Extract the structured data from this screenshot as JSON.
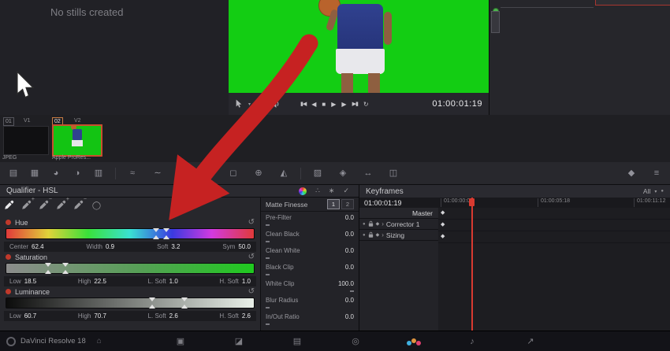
{
  "colors": {
    "annotation_arrow": "#c62222",
    "green_screen": "#13cd13",
    "playhead": "#d83a30",
    "clip_selection": "#c8502e"
  },
  "glyphs": {
    "caret_down": "▾",
    "reset": "↺",
    "keyframe_diamond": "◆",
    "enable_dot": "●",
    "expand_chevron": "›",
    "circle_tool": "◯",
    "nodes_icon": "∴",
    "snowflake_icon": "∗",
    "check_icon": "✓",
    "home": "⌂"
  },
  "gallery": {
    "empty_text": "No stills created"
  },
  "viewer": {
    "timecode": "01:00:01:19",
    "tool_icons": [
      "pointer-mode",
      "unmix-stack",
      "speaker"
    ],
    "transport": [
      {
        "name": "jump-start",
        "glyph": "▮◀"
      },
      {
        "name": "step-back",
        "glyph": "◀"
      },
      {
        "name": "stop",
        "glyph": "■"
      },
      {
        "name": "play",
        "glyph": "▶"
      },
      {
        "name": "step-forward",
        "glyph": "▶"
      },
      {
        "name": "jump-end",
        "glyph": "▶▮"
      },
      {
        "name": "loop",
        "glyph": "↻"
      }
    ]
  },
  "clipstrip": {
    "clips": [
      {
        "number": "01",
        "track": "V1",
        "codec": "JPEG",
        "selected": false
      },
      {
        "number": "02",
        "track": "V2",
        "codec": "Apple ProRes...",
        "selected": true
      }
    ]
  },
  "palette_toolbar": {
    "items": [
      {
        "name": "camera-raw",
        "glyph": "▤"
      },
      {
        "name": "color-match",
        "glyph": "▦"
      },
      {
        "name": "color-wheels",
        "glyph": "◕"
      },
      {
        "name": "hdr",
        "glyph": "◑"
      },
      {
        "name": "rgb-mixer",
        "glyph": "▥"
      },
      {
        "name": "motion-effects",
        "glyph": "≈"
      },
      {
        "name": "curves",
        "glyph": "∼"
      },
      {
        "name": "color-warper",
        "glyph": "◇"
      },
      {
        "name": "qualifier",
        "active": true
      },
      {
        "name": "window",
        "glyph": "◻"
      },
      {
        "name": "tracker",
        "glyph": "⊕"
      },
      {
        "name": "magic-mask",
        "glyph": "◭"
      },
      {
        "name": "blur",
        "glyph": "▨"
      },
      {
        "name": "key",
        "glyph": "◈"
      },
      {
        "name": "sizing",
        "glyph": "↔"
      },
      {
        "name": "stereo-3d",
        "glyph": "◫"
      }
    ],
    "right_items": [
      {
        "name": "keyframes-toggle",
        "glyph": "◆"
      },
      {
        "name": "panel-menu",
        "glyph": "≡"
      }
    ]
  },
  "qualifier": {
    "title": "Qualifier - HSL",
    "header_icons": [
      "color-wheel",
      "nodes",
      "snowflake",
      "matte-check"
    ],
    "picker_tools": [
      {
        "name": "eyedropper",
        "mod": ""
      },
      {
        "name": "eyedropper-add",
        "mod": "+"
      },
      {
        "name": "eyedropper-subtract",
        "mod": "−"
      },
      {
        "name": "softness-add",
        "mod": "+"
      },
      {
        "name": "softness-subtract",
        "mod": "−"
      },
      {
        "name": "mask-invert",
        "mod": ""
      }
    ],
    "sections": [
      {
        "name": "Hue",
        "params": [
          {
            "label": "Center",
            "value": "62.4"
          },
          {
            "label": "Width",
            "value": "0.9"
          },
          {
            "label": "Soft",
            "value": "3.2"
          },
          {
            "label": "Sym",
            "value": "50.0"
          }
        ]
      },
      {
        "name": "Saturation",
        "params": [
          {
            "label": "Low",
            "value": "18.5"
          },
          {
            "label": "High",
            "value": "22.5"
          },
          {
            "label": "L. Soft",
            "value": "1.0"
          },
          {
            "label": "H. Soft",
            "value": "1.0"
          }
        ]
      },
      {
        "name": "Luminance",
        "params": [
          {
            "label": "Low",
            "value": "60.7"
          },
          {
            "label": "High",
            "value": "70.7"
          },
          {
            "label": "L. Soft",
            "value": "2.6"
          },
          {
            "label": "H. Soft",
            "value": "2.6"
          }
        ]
      }
    ]
  },
  "matte_finesse": {
    "title": "Matte Finesse",
    "pages": [
      {
        "label": "1",
        "active": true
      },
      {
        "label": "2",
        "active": false
      }
    ],
    "params": [
      {
        "label": "Pre-Filter",
        "value": "0.0"
      },
      {
        "label": "Clean Black",
        "value": "0.0"
      },
      {
        "label": "Clean White",
        "value": "0.0"
      },
      {
        "label": "Black Clip",
        "value": "0.0"
      },
      {
        "label": "White Clip",
        "value": "100.0"
      },
      {
        "label": "Blur Radius",
        "value": "0.0"
      },
      {
        "label": "In/Out Ratio",
        "value": "0.0"
      }
    ]
  },
  "keyframes": {
    "title": "Keyframes",
    "filter": "All",
    "current_timecode": "01:00:01:19",
    "ruler_labels": [
      "01:00:00:00",
      "01:00:05:18",
      "01:00:11:12"
    ],
    "tracks": [
      {
        "label": "Master",
        "keyframe": true
      },
      {
        "label": "Corrector 1",
        "keyframe": true
      },
      {
        "label": "Sizing",
        "keyframe": true
      }
    ]
  },
  "statusbar": {
    "app_label": "DaVinci Resolve 18",
    "pages": [
      {
        "name": "media",
        "glyph": "▣",
        "active": false
      },
      {
        "name": "cut",
        "glyph": "◪",
        "active": false
      },
      {
        "name": "edit",
        "glyph": "▤",
        "active": false
      },
      {
        "name": "fusion",
        "glyph": "◎",
        "active": false
      },
      {
        "name": "color",
        "active": true
      },
      {
        "name": "fairlight",
        "glyph": "♪",
        "active": false
      },
      {
        "name": "deliver",
        "glyph": "↗",
        "active": false
      }
    ]
  }
}
